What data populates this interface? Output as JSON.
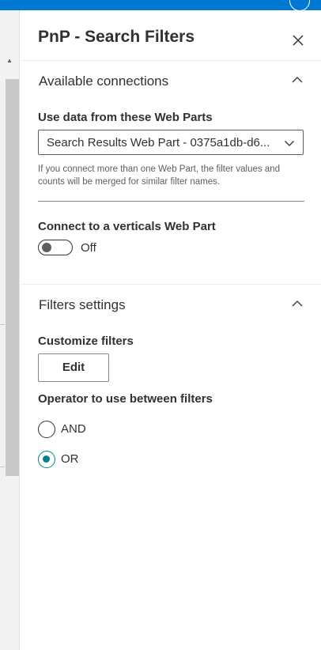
{
  "panel": {
    "title": "PnP - Search Filters"
  },
  "connections": {
    "section_title": "Available connections",
    "use_data_label": "Use data from these Web Parts",
    "dropdown_value": "Search Results Web Part - 0375a1db-d6...",
    "help_text": "If you connect more than one Web Part, the filter values and counts will be merged for similar filter names.",
    "verticals_label": "Connect to a verticals Web Part",
    "toggle_state": "Off"
  },
  "filters": {
    "section_title": "Filters settings",
    "customize_label": "Customize filters",
    "edit_button": "Edit",
    "operator_label": "Operator to use between filters",
    "options": [
      {
        "label": "AND",
        "checked": false
      },
      {
        "label": "OR",
        "checked": true
      }
    ]
  },
  "colors": {
    "topbar": "#0078d4",
    "accent": "#038387",
    "text": "#323130",
    "secondary_text": "#605e5c"
  }
}
